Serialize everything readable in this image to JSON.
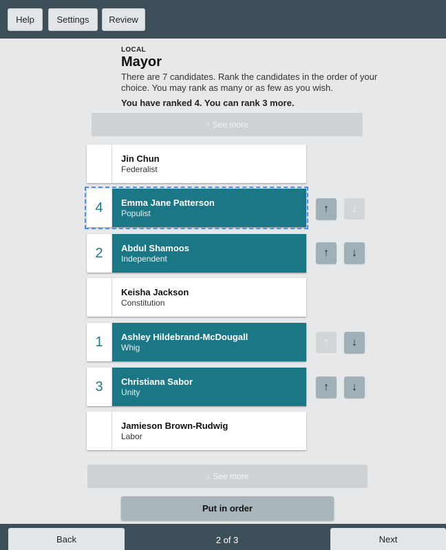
{
  "toolbar": {
    "help": "Help",
    "settings": "Settings",
    "review": "Review"
  },
  "contest": {
    "district": "LOCAL",
    "title": "Mayor",
    "description": "There are 7 candidates. Rank the candidates in the order of your choice. You may rank as many or as few as you wish.",
    "status": "You have ranked 4. You can rank 3 more."
  },
  "see_more_up": "↑ See more",
  "see_more_down": "↓ See more",
  "candidates": [
    {
      "name": "Jin Chun",
      "party": "Federalist",
      "rank": ""
    },
    {
      "name": "Emma Jane Patterson",
      "party": "Populist",
      "rank": "4"
    },
    {
      "name": "Abdul Shamoos",
      "party": "Independent",
      "rank": "2"
    },
    {
      "name": "Keisha Jackson",
      "party": "Constitution",
      "rank": ""
    },
    {
      "name": "Ashley Hildebrand-McDougall",
      "party": "Whig",
      "rank": "1"
    },
    {
      "name": "Christiana Sabor",
      "party": "Unity",
      "rank": "3"
    },
    {
      "name": "Jamieson Brown-Rudwig",
      "party": "Labor",
      "rank": ""
    }
  ],
  "icons": {
    "up": "arrow-up-icon",
    "down": "arrow-down-icon"
  },
  "put_in_order": "Put in order",
  "footer": {
    "back": "Back",
    "page": "2 of 3",
    "next": "Next"
  },
  "colors": {
    "ranked": "#1b7785",
    "header": "#3d4f58",
    "focus": "#4a8cff"
  }
}
